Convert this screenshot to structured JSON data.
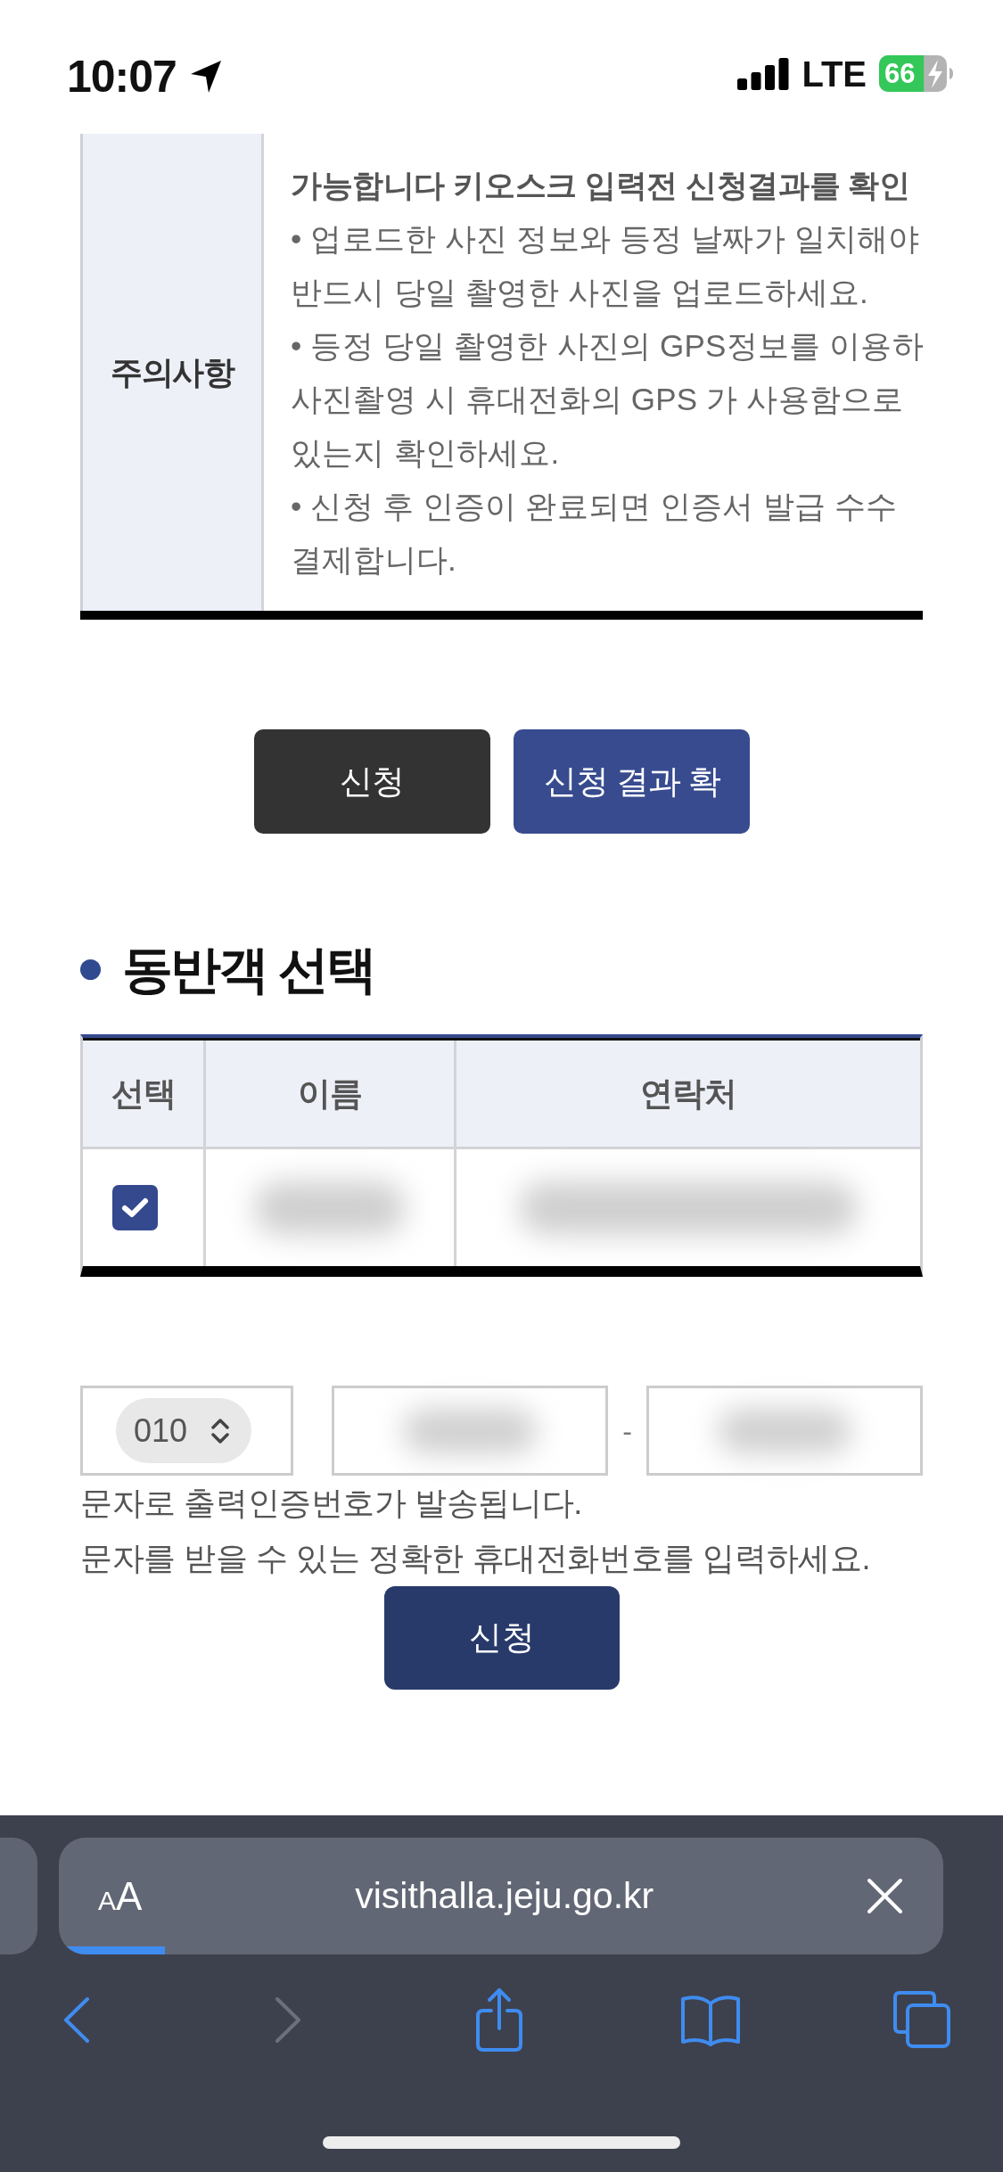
{
  "status_bar": {
    "time": "10:07",
    "network": "LTE",
    "battery": {
      "text": "66",
      "charging": true
    }
  },
  "notice": {
    "label": "주의사항",
    "items": [
      {
        "bold": true,
        "lines": [
          "가능합니다 키오스크 입력전 신청결과를 확인"
        ]
      },
      {
        "bold": false,
        "lines": [
          "• 업로드한 사진 정보와 등정 날짜가 일치해야",
          "반드시 당일 촬영한 사진을 업로드하세요."
        ]
      },
      {
        "bold": false,
        "lines": [
          "• 등정 당일 촬영한 사진의 GPS정보를 이용하",
          "사진촬영 시 휴대전화의 GPS 가 사용함으로",
          "있는지 확인하세요."
        ]
      },
      {
        "bold": false,
        "lines": [
          "• 신청 후 인증이 완료되면 인증서 발급 수수",
          "결제합니다."
        ]
      }
    ]
  },
  "actions": [
    {
      "label": "신청",
      "kind": "dark"
    },
    {
      "label": "신청 결과 확",
      "kind": "primary"
    }
  ],
  "companion_section": {
    "title": "동반객 선택",
    "columns": [
      "선택",
      "이름",
      "연락처"
    ],
    "rows": [
      {
        "checked": true
      }
    ]
  },
  "phone": {
    "prefix": "010",
    "separator": "-",
    "hint_lines": [
      "문자로 출력인증번호가 발송됩니다.",
      "문자를 받을 수 있는 정확한 휴대전화번호를 입력하세요."
    ],
    "submit": "신청"
  },
  "browser": {
    "format_button": "AA",
    "url": "visithalla.jeju.go.kr",
    "load_progress": {
      "level": 0.12
    },
    "toolbar": [
      {
        "kind": "back",
        "disabled": false
      },
      {
        "kind": "forward",
        "disabled": true
      },
      {
        "kind": "share",
        "disabled": false
      },
      {
        "kind": "bookmarks",
        "disabled": false
      },
      {
        "kind": "tabs",
        "disabled": false
      }
    ]
  }
}
